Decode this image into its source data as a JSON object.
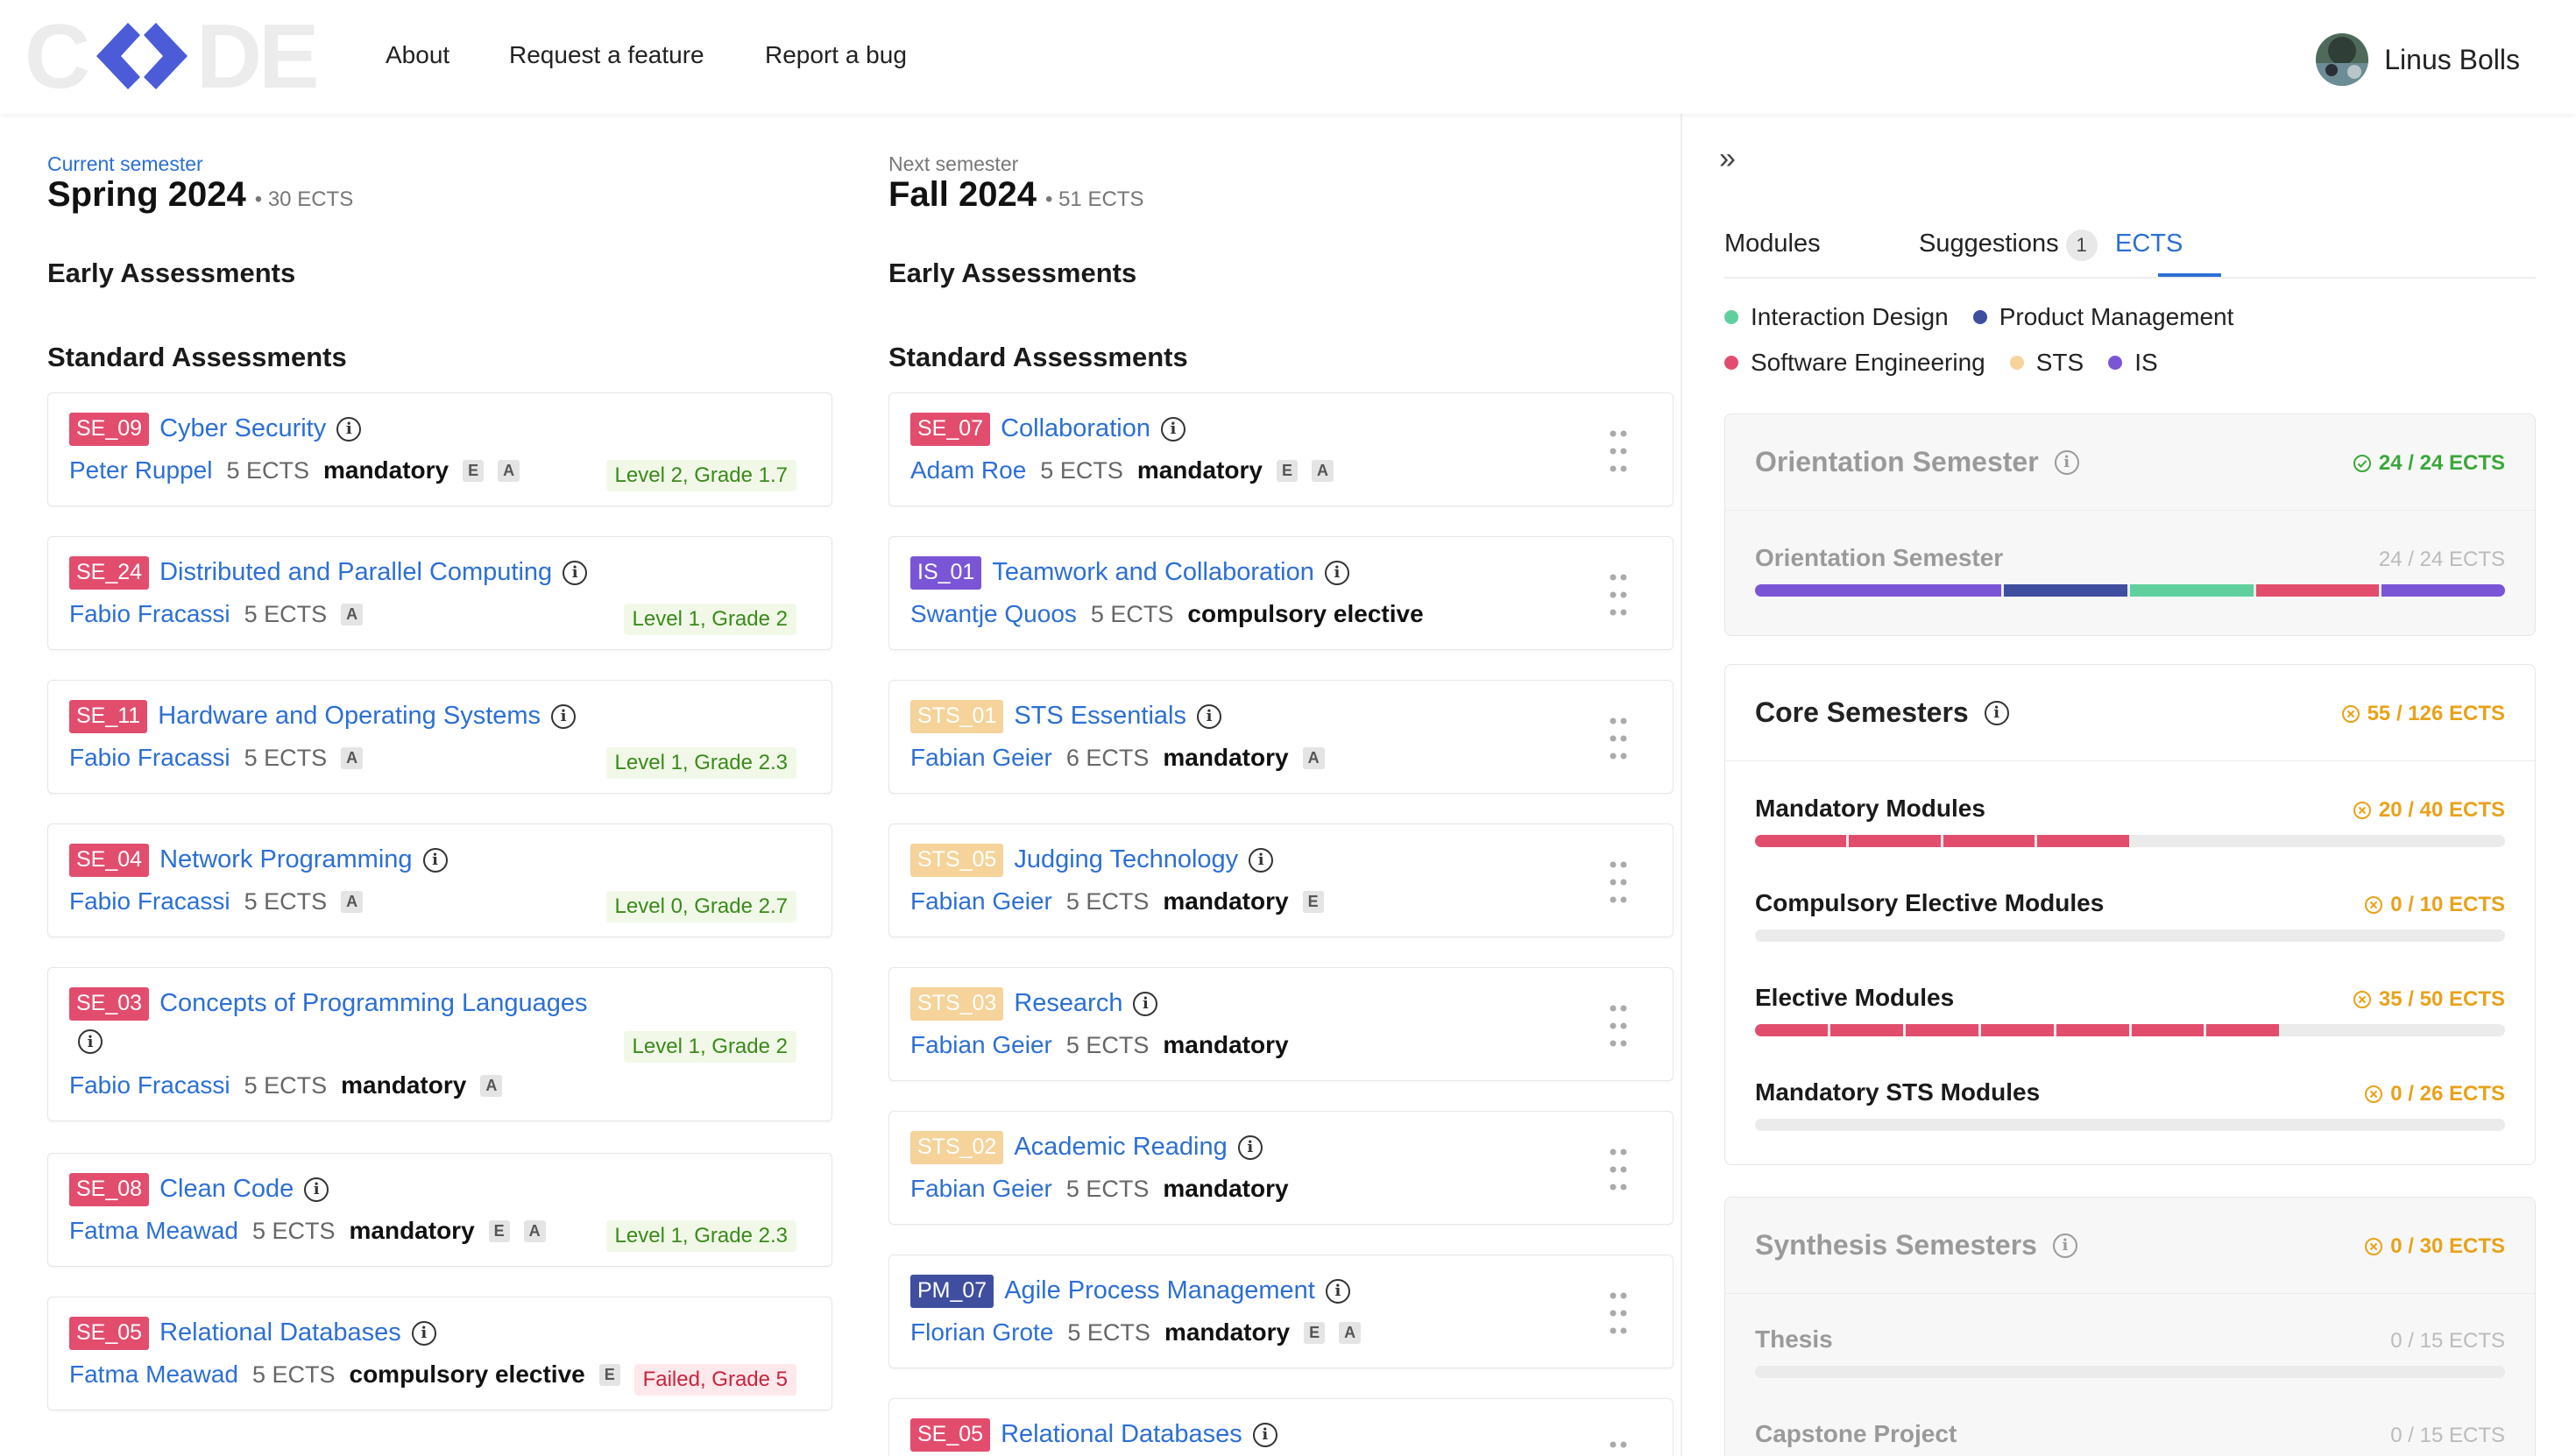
{
  "header": {
    "logo_text": "CODE",
    "nav": [
      "About",
      "Request a feature",
      "Report a bug"
    ],
    "user_name": "Linus Bolls"
  },
  "current": {
    "label": "Current semester",
    "title": "Spring 2024",
    "ects": "• 30 ECTS",
    "early": "Early Assessments",
    "standard": "Standard Assessments",
    "cards": [
      {
        "code": "SE_09",
        "title": "Cyber Security",
        "person": "Peter Ruppel",
        "ects": "5 ECTS",
        "req": "mandatory",
        "tags": [
          "E",
          "A"
        ],
        "grade": "Level 2, Grade 1.7"
      },
      {
        "code": "SE_24",
        "title": "Distributed and Parallel Computing",
        "person": "Fabio Fracassi",
        "ects": "5 ECTS",
        "req": "",
        "tags": [
          "A"
        ],
        "grade": "Level 1, Grade 2"
      },
      {
        "code": "SE_11",
        "title": "Hardware and Operating Systems",
        "person": "Fabio Fracassi",
        "ects": "5 ECTS",
        "req": "",
        "tags": [
          "A"
        ],
        "grade": "Level 1, Grade 2.3"
      },
      {
        "code": "SE_04",
        "title": "Network Programming",
        "person": "Fabio Fracassi",
        "ects": "5 ECTS",
        "req": "",
        "tags": [
          "A"
        ],
        "grade": "Level 0, Grade 2.7"
      },
      {
        "code": "SE_03",
        "title": "Concepts of Programming Languages",
        "person": "Fabio Fracassi",
        "ects": "5 ECTS",
        "req": "mandatory",
        "tags": [
          "A"
        ],
        "grade": "Level 1, Grade 2"
      },
      {
        "code": "SE_08",
        "title": "Clean Code",
        "person": "Fatma Meawad",
        "ects": "5 ECTS",
        "req": "mandatory",
        "tags": [
          "E",
          "A"
        ],
        "grade": "Level 1, Grade 2.3"
      },
      {
        "code": "SE_05",
        "title": "Relational Databases",
        "person": "Fatma Meawad",
        "ects": "5 ECTS",
        "req": "compulsory elective",
        "tags": [
          "E"
        ],
        "grade": "Failed, Grade 5"
      }
    ]
  },
  "next": {
    "label": "Next semester",
    "title": "Fall 2024",
    "ects": "• 51 ECTS",
    "early": "Early Assessments",
    "standard": "Standard Assessments",
    "cards": [
      {
        "code": "SE_07",
        "title": "Collaboration",
        "person": "Adam Roe",
        "ects": "5 ECTS",
        "req": "mandatory",
        "tags": [
          "E",
          "A"
        ]
      },
      {
        "code": "IS_01",
        "title": "Teamwork and Collaboration",
        "person": "Swantje Quoos",
        "ects": "5 ECTS",
        "req": "compulsory elective",
        "tags": []
      },
      {
        "code": "STS_01",
        "title": "STS Essentials",
        "person": "Fabian Geier",
        "ects": "6 ECTS",
        "req": "mandatory",
        "tags": [
          "A"
        ]
      },
      {
        "code": "STS_05",
        "title": "Judging Technology",
        "person": "Fabian Geier",
        "ects": "5 ECTS",
        "req": "mandatory",
        "tags": [
          "E"
        ]
      },
      {
        "code": "STS_03",
        "title": "Research",
        "person": "Fabian Geier",
        "ects": "5 ECTS",
        "req": "mandatory",
        "tags": []
      },
      {
        "code": "STS_02",
        "title": "Academic Reading",
        "person": "Fabian Geier",
        "ects": "5 ECTS",
        "req": "mandatory",
        "tags": []
      },
      {
        "code": "PM_07",
        "title": "Agile Process Management",
        "person": "Florian Grote",
        "ects": "5 ECTS",
        "req": "mandatory",
        "tags": [
          "E",
          "A"
        ]
      },
      {
        "code": "SE_05",
        "title": "Relational Databases",
        "person": "",
        "ects": "",
        "req": "",
        "tags": []
      }
    ]
  },
  "panel": {
    "collapse_glyph": "»",
    "tabs": [
      "Modules",
      "Suggestions",
      "ECTS"
    ],
    "suggestions_count": "1",
    "active_tab": "ECTS",
    "legend": [
      {
        "label": "Interaction Design",
        "color": "#5fcf9e"
      },
      {
        "label": "Product Management",
        "color": "#3f4e9e"
      },
      {
        "label": "Software Engineering",
        "color": "#e24d6e"
      },
      {
        "label": "STS",
        "color": "#f5d39a"
      },
      {
        "label": "IS",
        "color": "#7a55d6"
      }
    ],
    "orientation": {
      "title": "Orientation Semester",
      "status": "24 / 24 ECTS",
      "sub_title": "Orientation Semester",
      "sub_status": "24 / 24 ECTS",
      "progress": 1.0
    },
    "core": {
      "title": "Core Semesters",
      "status": "55 / 126 ECTS",
      "subs": [
        {
          "title": "Mandatory Modules",
          "status": "20 / 40 ECTS",
          "filled": 4,
          "total": 8
        },
        {
          "title": "Compulsory Elective Modules",
          "status": "0 / 10 ECTS",
          "filled": 0,
          "total": 2
        },
        {
          "title": "Elective Modules",
          "status": "35 / 50 ECTS",
          "filled": 7,
          "total": 10
        },
        {
          "title": "Mandatory STS Modules",
          "status": "0 / 26 ECTS",
          "filled": 0,
          "total": 5
        }
      ]
    },
    "synthesis": {
      "title": "Synthesis Semesters",
      "status": "0 / 30 ECTS",
      "subs": [
        {
          "title": "Thesis",
          "status": "0 / 15 ECTS"
        },
        {
          "title": "Capstone Project",
          "status": "0 / 15 ECTS"
        }
      ]
    }
  }
}
